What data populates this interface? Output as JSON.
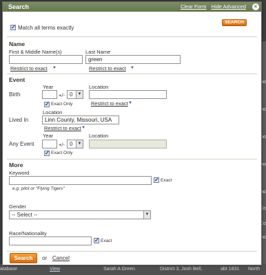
{
  "dialog": {
    "title": "Search",
    "clear_form": "Clear Form",
    "hide_advanced": "Hide Advanced",
    "close_glyph": "×",
    "accent_color": "#66774f"
  },
  "top": {
    "match_all_label": "Match all terms exactly",
    "search_button": "SEARCH"
  },
  "name_section": {
    "heading": "Name",
    "first_label": "First & Middle Name(s)",
    "first_value": "",
    "last_label": "Last Name",
    "last_value": "green",
    "restrict_first": "Restrict to exact",
    "restrict_last": "Restrict to exact"
  },
  "event_section": {
    "heading": "Event",
    "birth_label": "Birth",
    "year_label": "Year",
    "location_label": "Location",
    "plusminus": "+/-",
    "birth_range": "0",
    "exact_only": "Exact Only",
    "restrict_birth_loc": "Restrict to exact",
    "lived_in_label": "Lived In",
    "lived_location_label": "Location",
    "lived_value": "Linn County, Missouri, USA",
    "restrict_lived": "Restrict to exact",
    "any_event_label": "Any Event",
    "any_year_label": "Year",
    "any_location_label": "Location",
    "any_range": "0",
    "any_exact_only": "Exact Only"
  },
  "more_section": {
    "heading": "More",
    "keyword_label": "Keyword",
    "keyword_placeholder": "e.g. pilot or \"Flying Tigers\"",
    "exact": "Exact",
    "gender_label": "Gender",
    "gender_value": "-- Select --",
    "race_label": "Race/Nationality",
    "race_exact": "Exact"
  },
  "footer": {
    "search_button": "Search",
    "or_text": "or",
    "cancel_link": "Cancel"
  },
  "background": {
    "side_labels": [
      "ho",
      "ho",
      "ho",
      "ho",
      "ho",
      "Co",
      "Co",
      "ho"
    ],
    "bottom_db": "atabase",
    "bottom_view": "View",
    "bottom_name": "Sarah A Green",
    "bottom_district": "District 3, Josh Bell,",
    "bottom_year": "abt 1831",
    "bottom_place": "North"
  }
}
